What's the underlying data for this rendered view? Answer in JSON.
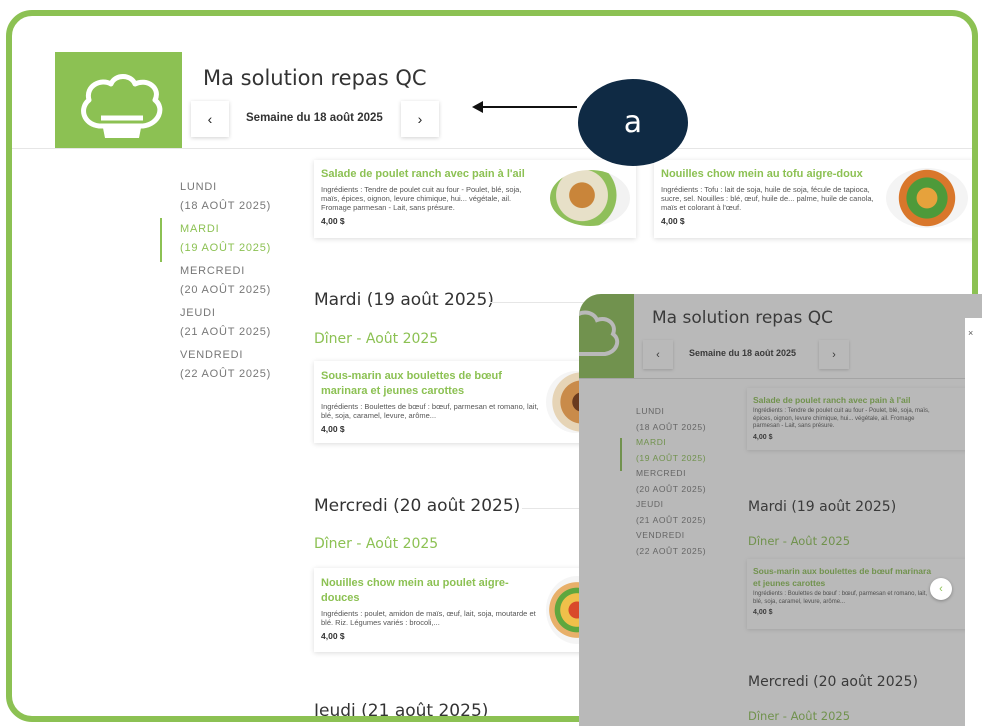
{
  "app": {
    "title": "Ma solution repas QC",
    "week_label": "Semaine du 18 août 2025",
    "prev": "‹",
    "next": "›"
  },
  "callout": {
    "label": "a"
  },
  "day_nav": [
    {
      "day": "LUNDI",
      "date": "(18 AOÛT 2025)",
      "active": false
    },
    {
      "day": "MARDI",
      "date": "(19 AOÛT 2025)",
      "active": true
    },
    {
      "day": "MERCREDI",
      "date": "(20 AOÛT 2025)",
      "active": false
    },
    {
      "day": "JEUDI",
      "date": "(21 AOÛT 2025)",
      "active": false
    },
    {
      "day": "VENDREDI",
      "date": "(22 AOÛT 2025)",
      "active": false
    }
  ],
  "top_cards": [
    {
      "name": "Salade de poulet ranch avec pain à l'ail",
      "ingredients": "Ingrédients : Tendre de poulet cuit au four - Poulet, blé, soja, maïs, épices, oignon, levure chimique, hui... végétale, ail. Fromage parmesan - Lait, sans présure.",
      "price": "4,00 $"
    },
    {
      "name": "Nouilles chow mein au tofu aigre-doux",
      "ingredients": "Ingrédients : Tofu : lait de soja, huile de soja, fécule de tapioca, sucre, sel. Nouilles : blé, œuf, huile de... palme, huile de canola, maïs et colorant à l'œuf.",
      "price": "4,00 $"
    }
  ],
  "sections": [
    {
      "heading": "Mardi (19 août 2025)",
      "meal": "Dîner - Août 2025",
      "card": {
        "name": "Sous-marin aux boulettes de bœuf marinara et jeunes carottes",
        "ingredients": "Ingrédients : Boulettes de bœuf : bœuf, parmesan et romano, lait, blé, soja, caramel, levure, arôme...",
        "price": "4,00 $"
      }
    },
    {
      "heading": "Mercredi (20 août 2025)",
      "meal": "Dîner - Août 2025",
      "card": {
        "name": "Nouilles chow mein au poulet aigre-douces",
        "ingredients": "Ingrédients : poulet, amidon de maïs, œuf, lait, soja, moutarde et blé. Riz. Légumes variés : brocoli,...",
        "price": "4,00 $"
      }
    },
    {
      "heading": "Jeudi (21 août 2025)"
    }
  ],
  "overlay": {
    "title": "Ma solution repas QC",
    "week_label": "Semaine du 18 août 2025",
    "day_nav": [
      {
        "day": "LUNDI",
        "date": "(18 AOÛT 2025)"
      },
      {
        "day": "MARDI",
        "date": "(19 AOÛT 2025)"
      },
      {
        "day": "MERCREDI",
        "date": "(20 AOÛT 2025)"
      },
      {
        "day": "JEUDI",
        "date": "(21 AOÛT 2025)"
      },
      {
        "day": "VENDREDI",
        "date": "(22 AOÛT 2025)"
      }
    ],
    "card1": {
      "name": "Salade de poulet ranch avec pain à l'ail",
      "ingredients": "Ingrédients : Tendre de poulet cuit au four - Poulet, blé, soja, maïs, épices, oignon, levure chimique, hui... végétale, ail. Fromage parmesan - Lait, sans présure.",
      "price": "4,00 $"
    },
    "heading1": "Mardi (19 août 2025)",
    "meal1": "Dîner - Août 2025",
    "card2": {
      "name": "Sous-marin aux boulettes de bœuf marinara et jeunes carottes",
      "ingredients": "Ingrédients : Boulettes de bœuf : bœuf, parmesan et romano, lait, blé, soja, caramel, levure, arôme...",
      "price": "4,00 $"
    },
    "heading2": "Mercredi (20 août 2025)",
    "meal2": "Dîner - Août 2025",
    "carousel_prev": "‹",
    "close": "×"
  },
  "colors": {
    "brand": "#8cc153",
    "callout": "#0f2a44"
  }
}
